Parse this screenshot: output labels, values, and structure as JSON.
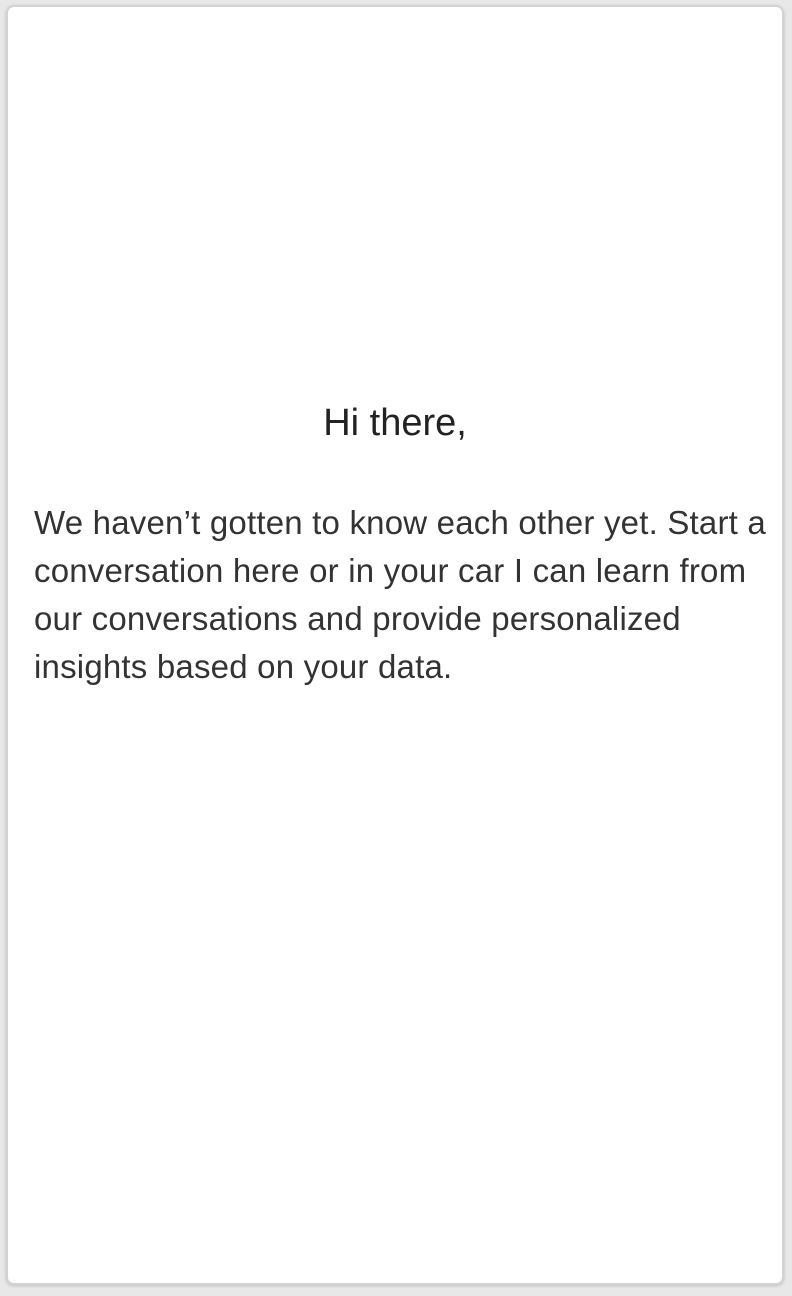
{
  "intro": {
    "greeting": "Hi there,",
    "message": "We haven’t gotten to know each other yet. Start a conversation here or in your car I can learn from our conversations and provide personalized insights based on your data."
  },
  "colors": {
    "background": "#ffffff",
    "text": "#222222"
  }
}
